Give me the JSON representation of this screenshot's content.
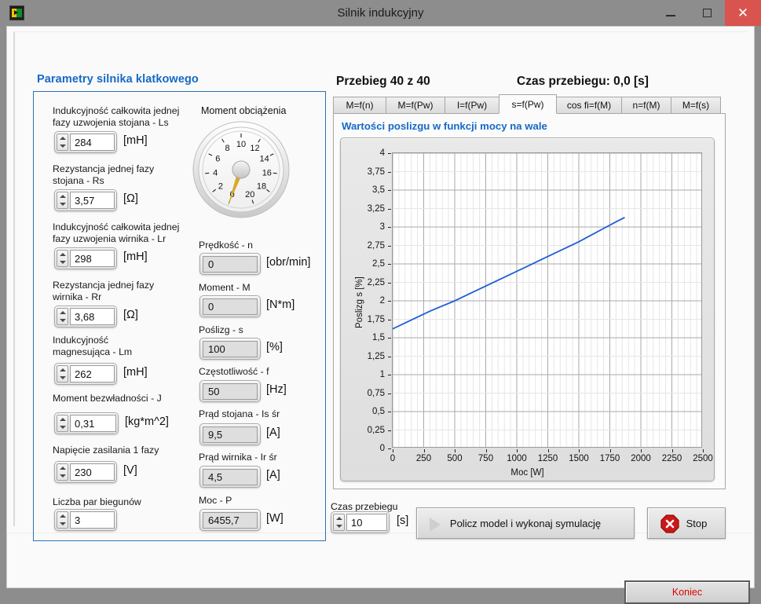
{
  "window": {
    "title": "Silnik indukcyjny",
    "icon": "labview-app-icon",
    "minimize": "minimize-icon",
    "maximize": "maximize-icon",
    "close": "✕"
  },
  "params": {
    "title": "Parametry silnika klatkowego",
    "controls": [
      {
        "label": "Indukcyjność całkowita jednej\nfazy uzwojenia stojana - Ls",
        "value": "284",
        "unit": "[mH]",
        "name": "ls"
      },
      {
        "label": "Rezystancja jednej fazy\nstojana - Rs",
        "value": "3,57",
        "unit": "[Ω]",
        "name": "rs"
      },
      {
        "label": "Indukcyjność całkowita jednej\nfazy uzwojenia wirnika - Lr",
        "value": "298",
        "unit": "[mH]",
        "name": "lr"
      },
      {
        "label": "Rezystancja jednej fazy\n wirnika - Rr",
        "value": "3,68",
        "unit": "[Ω]",
        "name": "rr"
      },
      {
        "label": "Indukcyjność\nmagnesująca - Lm",
        "value": "262",
        "unit": "[mH]",
        "name": "lm"
      },
      {
        "label": "Moment bezwładności - J",
        "value": "0,31",
        "unit": "[kg*m^2]",
        "name": "j"
      },
      {
        "label": "Napięcie zasilania 1 fazy",
        "value": "230",
        "unit": "[V]",
        "name": "u"
      },
      {
        "label": "Liczba par biegunów",
        "value": "3",
        "unit": "",
        "name": "p"
      }
    ]
  },
  "gauge": {
    "label": "Moment obciążenia",
    "min": 0,
    "max": 20,
    "step": 2,
    "value": 0,
    "ticks": [
      "0",
      "2",
      "4",
      "6",
      "8",
      "10",
      "12",
      "14",
      "16",
      "18",
      "20"
    ],
    "needle_color": "#d9a825"
  },
  "indicators": [
    {
      "label": "Prędkość - n",
      "value": "0",
      "unit": "[obr/min]",
      "name": "n"
    },
    {
      "label": "Moment - M",
      "value": "0",
      "unit": "[N*m]",
      "name": "m"
    },
    {
      "label": "Poślizg - s",
      "value": "100",
      "unit": "[%]",
      "name": "s"
    },
    {
      "label": "Częstotliwość - f",
      "value": "50",
      "unit": "[Hz]",
      "name": "f"
    },
    {
      "label": "Prąd stojana - Is śr",
      "value": "9,5",
      "unit": "[A]",
      "name": "is"
    },
    {
      "label": "Prąd wirnika - Ir śr",
      "value": "4,5",
      "unit": "[A]",
      "name": "ir"
    },
    {
      "label": "Moc - P",
      "value": "6455,7",
      "unit": "[W]",
      "name": "p"
    }
  ],
  "header": {
    "run_counter": "Przebieg 40 z 40",
    "run_time": "Czas przebiegu: 0,0 [s]"
  },
  "tabs": [
    {
      "label": "M=f(n)",
      "active": false
    },
    {
      "label": "M=f(Pw)",
      "active": false
    },
    {
      "label": "I=f(Pw)",
      "active": false
    },
    {
      "label": "s=f(Pw)",
      "active": true
    },
    {
      "label": "cos fi=f(M)",
      "active": false
    },
    {
      "label": "n=f(M)",
      "active": false
    },
    {
      "label": "M=f(s)",
      "active": false
    }
  ],
  "chart_data": {
    "type": "line",
    "title": "Wartości poslizgu w funkcji mocy na wale",
    "xlabel": "Moc [W]",
    "ylabel": "Poslizg s [%]",
    "xlim": [
      0,
      2500
    ],
    "ylim": [
      0,
      4
    ],
    "xticks": [
      0,
      250,
      500,
      750,
      1000,
      1250,
      1500,
      1750,
      2000,
      2250,
      2500
    ],
    "xtick_labels": [
      "0",
      "250",
      "500",
      "750",
      "1000",
      "1250",
      "1500",
      "1750",
      "2000",
      "2250",
      "2500"
    ],
    "yticks": [
      0,
      0.25,
      0.5,
      0.75,
      1,
      1.25,
      1.5,
      1.75,
      2,
      2.25,
      2.5,
      2.75,
      3,
      3.25,
      3.5,
      3.75,
      4
    ],
    "ytick_labels": [
      "0",
      "0,25",
      "0,5",
      "0,75",
      "1",
      "1,25",
      "1,5",
      "1,75",
      "2",
      "2,25",
      "2,5",
      "2,75",
      "3",
      "3,25",
      "3,5",
      "3,75",
      "4"
    ],
    "grid": true,
    "minor_grid": true,
    "legend": null,
    "series": [
      {
        "name": "s=f(Pw)",
        "color": "#1f5fd0",
        "x": [
          0,
          100,
          200,
          300,
          400,
          500,
          600,
          700,
          800,
          900,
          1000,
          1100,
          1200,
          1300,
          1400,
          1500,
          1600,
          1700,
          1800,
          1870
        ],
        "y": [
          1.62,
          1.7,
          1.78,
          1.86,
          1.93,
          2.0,
          2.08,
          2.16,
          2.24,
          2.32,
          2.4,
          2.48,
          2.56,
          2.64,
          2.72,
          2.8,
          2.89,
          2.98,
          3.07,
          3.13
        ]
      }
    ]
  },
  "bottom": {
    "czas_label": "Czas przebiegu",
    "czas_value": "10",
    "czas_unit": "[s]",
    "run_button": "Policz model i wykonaj symulację",
    "run_icon": "play-triangle-icon",
    "stop_button": "Stop",
    "stop_icon": "stop-octagon-icon",
    "exit_button": "Koniec"
  }
}
